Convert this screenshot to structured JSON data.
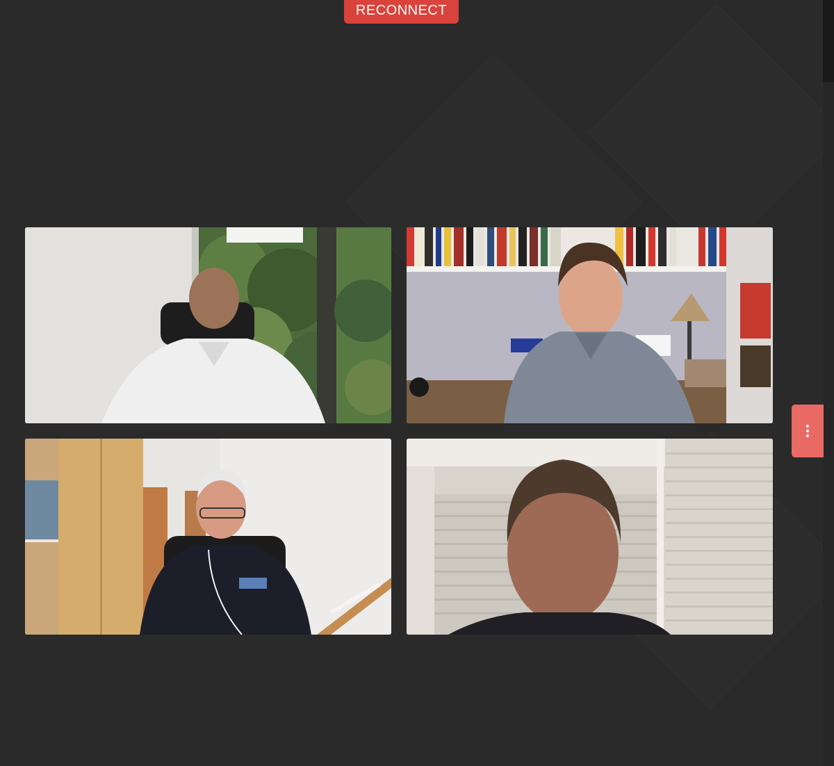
{
  "app": {
    "reconnect_label": "RECONNECT",
    "accent_color": "#d9433b",
    "menu_button_color": "#e96a64",
    "background_color": "#2a2a2b"
  },
  "participants": [
    {
      "id": "participant-1",
      "description_icon": "video-feed"
    },
    {
      "id": "participant-2",
      "description_icon": "video-feed"
    },
    {
      "id": "participant-3",
      "description_icon": "video-feed"
    },
    {
      "id": "participant-4",
      "description_icon": "video-feed"
    }
  ],
  "controls": {
    "more_options_icon": "more-vertical-icon"
  }
}
